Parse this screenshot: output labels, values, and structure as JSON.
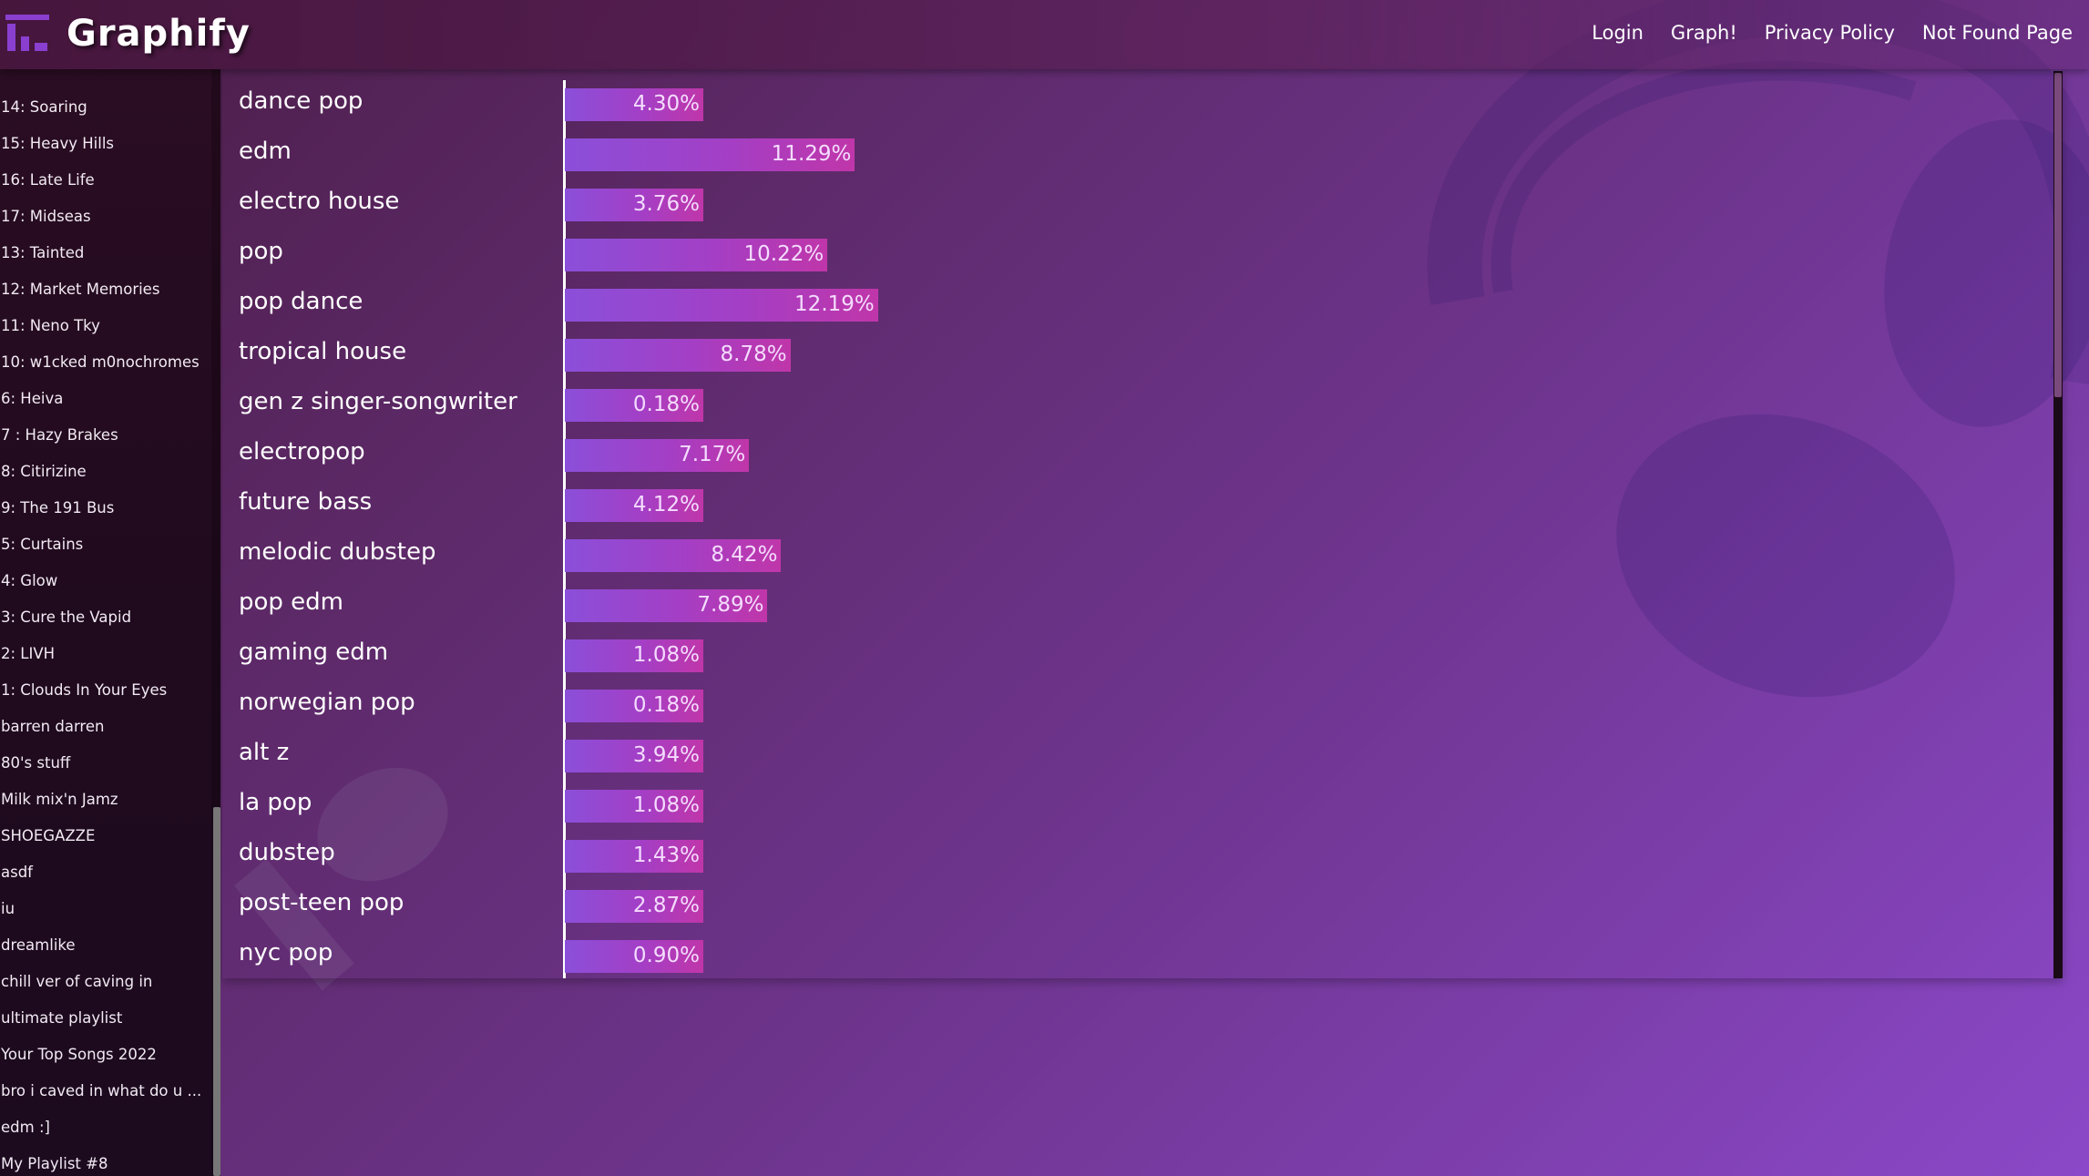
{
  "app": {
    "brand": "Graphify"
  },
  "nav": {
    "items": [
      "Login",
      "Graph!",
      "Privacy Policy",
      "Not Found Page"
    ]
  },
  "sidebar": {
    "items": [
      "14: Soaring",
      "15: Heavy Hills",
      "16: Late Life",
      "17: Midseas",
      "13: Tainted",
      "12: Market Memories",
      "11: Neno Tky",
      "10: w1cked m0nochromes",
      "6: Heiva",
      "7 : Hazy Brakes",
      "8: Citirizine",
      "9: The 191 Bus",
      "5: Curtains",
      "4: Glow",
      "3: Cure the Vapid",
      "2: LIVH",
      "1: Clouds In Your Eyes",
      "barren darren",
      "80's stuff",
      "Milk mix'n Jamz",
      "SHOEGAZZE",
      "asdf",
      "iu",
      "dreamlike",
      "chill ver of caving in",
      "ultimate playlist",
      "Your Top Songs 2022",
      "bro i caved in what do u ...",
      " edm :]",
      "My Playlist #8"
    ]
  },
  "colors": {
    "bar_start": "#8b4fd9",
    "bar_end": "#c036a9",
    "accent": "#7b3fc0"
  },
  "chart_data": {
    "type": "bar",
    "orientation": "horizontal",
    "categories": [
      "dance pop",
      "edm",
      "electro house",
      "pop",
      "pop dance",
      "tropical house",
      "gen z singer-songwriter",
      "electropop",
      "future bass",
      "melodic dubstep",
      "pop edm",
      "gaming edm",
      "norwegian pop",
      "alt z",
      "la pop",
      "dubstep",
      "post-teen pop",
      "nyc pop"
    ],
    "values": [
      4.3,
      11.29,
      3.76,
      10.22,
      12.19,
      8.78,
      0.18,
      7.17,
      4.12,
      8.42,
      7.89,
      1.08,
      0.18,
      3.94,
      1.08,
      1.43,
      2.87,
      0.9
    ],
    "labels": [
      "4.30%",
      "11.29%",
      "3.76%",
      "10.22%",
      "12.19%",
      "8.78%",
      "0.18%",
      "7.17%",
      "4.12%",
      "8.42%",
      "7.89%",
      "1.08%",
      "0.18%",
      "3.94%",
      "1.08%",
      "1.43%",
      "2.87%",
      "0.90%"
    ],
    "unit": "%",
    "title": "",
    "xlabel": "",
    "ylabel": ""
  }
}
